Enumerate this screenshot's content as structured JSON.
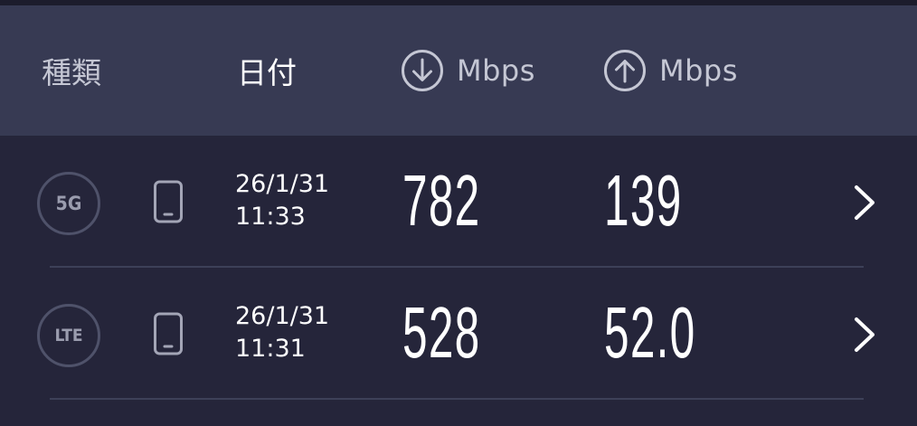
{
  "header": {
    "type_label": "種類",
    "date_label": "日付",
    "download_unit": "Mbps",
    "upload_unit": "Mbps",
    "download_icon": "arrow-down-circle-icon",
    "upload_icon": "arrow-up-circle-icon"
  },
  "results": [
    {
      "network": "5G",
      "device_icon": "phone-icon",
      "date": "26/1/31",
      "time": "11:33",
      "download": "782",
      "upload": "139"
    },
    {
      "network": "LTE",
      "device_icon": "phone-icon",
      "date": "26/1/31",
      "time": "11:31",
      "download": "528",
      "upload": "52.0"
    }
  ],
  "colors": {
    "background": "#25253a",
    "header_background": "#373a53",
    "muted_text": "#c5c7d4",
    "badge_border": "#4f526a",
    "divider": "#3d4058"
  }
}
